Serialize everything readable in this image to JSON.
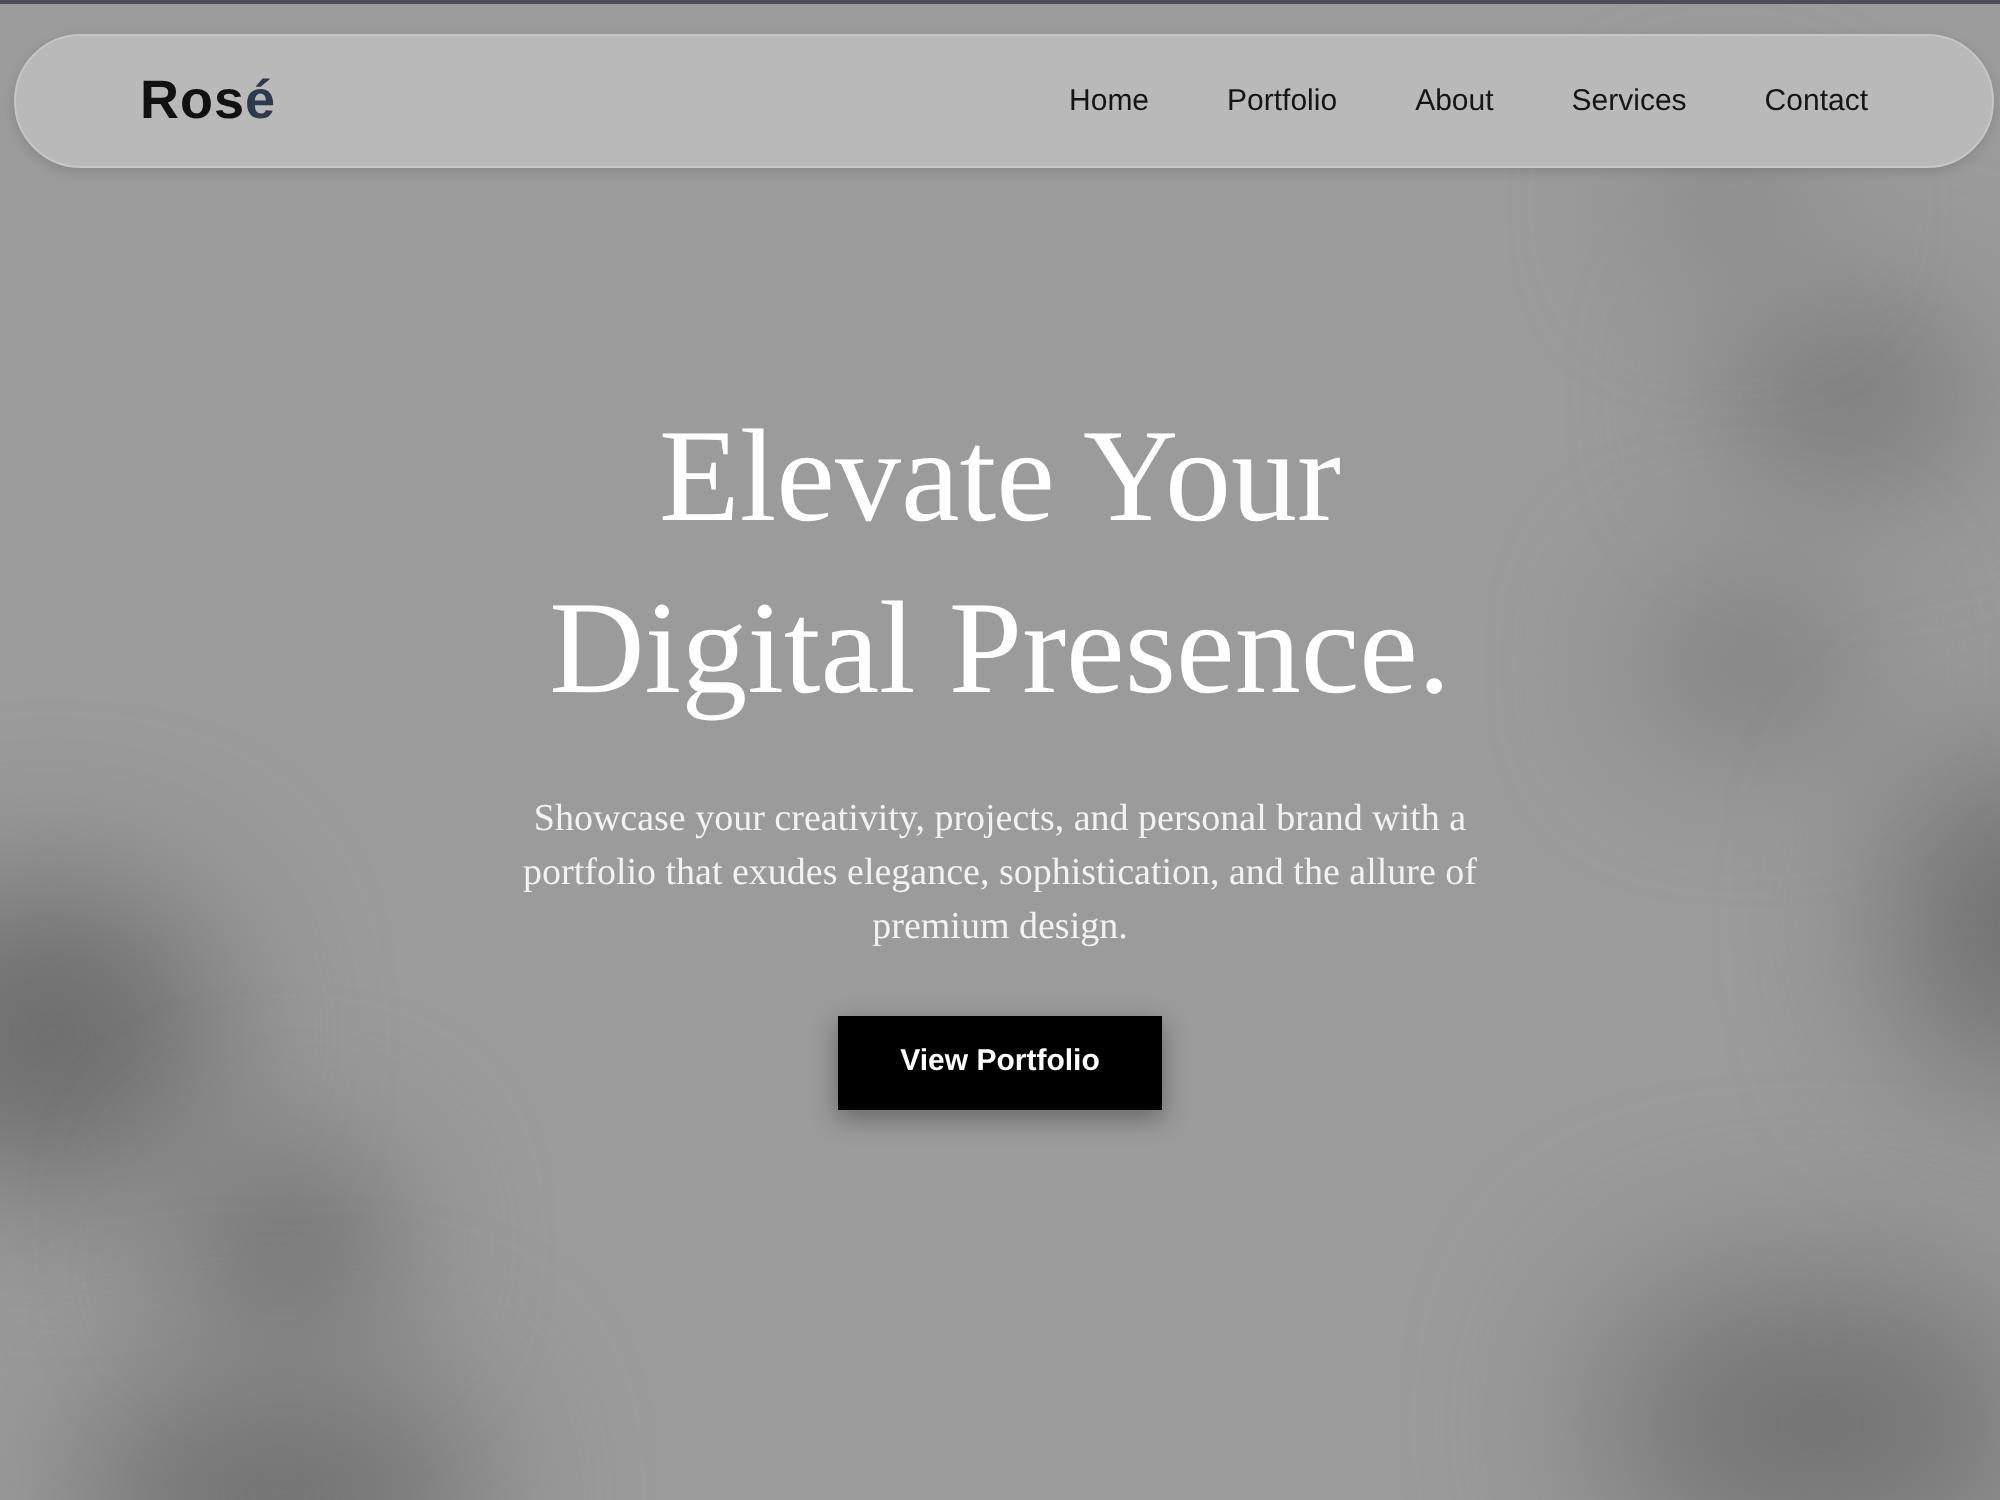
{
  "logo": {
    "text": "Ros",
    "accent": "é"
  },
  "nav": {
    "links": [
      {
        "label": "Home"
      },
      {
        "label": "Portfolio"
      },
      {
        "label": "About"
      },
      {
        "label": "Services"
      },
      {
        "label": "Contact"
      }
    ]
  },
  "hero": {
    "title": "Elevate Your Digital Presence.",
    "subtitle": "Showcase your creativity, projects, and personal brand with a portfolio that exudes elegance, sophistication, and the allure of premium design.",
    "button": "View Portfolio"
  }
}
